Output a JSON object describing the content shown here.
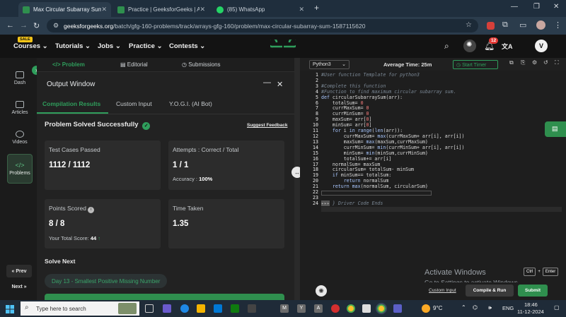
{
  "browser": {
    "tabs": [
      {
        "title": "Max Circular Subarray Sum | Pr",
        "active": true
      },
      {
        "title": "Practice | GeeksforGeeks | A co",
        "active": false
      },
      {
        "title": "(85) WhatsApp",
        "active": false
      }
    ],
    "url_host": "geeksforgeeks.org",
    "url_path": "/batch/gfg-160-problems/track/arrays-gfg-160/problem/max-circular-subarray-sum-1587115620"
  },
  "site": {
    "sale_badge": "SALE",
    "menu": [
      "Courses",
      "Tutorials",
      "Jobs",
      "Practice",
      "Contests"
    ],
    "logo": "GfG",
    "notification_count": "12",
    "avatar_letter": "V"
  },
  "sidebar": {
    "items": [
      "Dash",
      "Articles",
      "Videos",
      "Problems"
    ],
    "prev": "« Prev",
    "next": "Next »"
  },
  "problem_tabs": [
    "Problem",
    "Editorial",
    "Submissions"
  ],
  "output": {
    "title": "Output Window",
    "tabs": [
      "Compilation Results",
      "Custom Input",
      "Y.O.G.I. (AI Bot)"
    ],
    "status": "Problem Solved Successfully",
    "suggest_feedback": "Suggest Feedback",
    "test_cases_label": "Test Cases Passed",
    "test_cases_value": "1112 / 1112",
    "attempts_label": "Attempts : Correct / Total",
    "attempts_value": "1 / 1",
    "accuracy_label": "Accuracy :",
    "accuracy_value": "100%",
    "points_label": "Points Scored",
    "points_value": "8 / 8",
    "total_score_label": "Your Total Score:",
    "total_score_value": "44",
    "time_label": "Time Taken",
    "time_value": "1.35",
    "solve_next_label": "Solve Next",
    "next_problem": "Day 13 - Smallest Positive Missing Number"
  },
  "editor": {
    "language": "Python3",
    "average_time": "Average Time: 25m",
    "start_timer": "Start Timer",
    "custom_input": "Custom Input",
    "compile_run": "Compile & Run",
    "submit": "Submit",
    "activate_title": "Activate Windows",
    "activate_sub": "Go to Settings to activate Windows.",
    "kbd_ctrl": "Ctrl",
    "kbd_plus": "+",
    "kbd_enter": "Enter"
  },
  "taskbar": {
    "search_placeholder": "Type here to search",
    "weather": "9°C",
    "lang": "ENG",
    "time": "18:46",
    "date": "11-12-2024"
  },
  "colors": {
    "accent_green": "#2f9e5c",
    "submit_green": "#2f8f4e",
    "success_check": "#2f9e5c"
  }
}
